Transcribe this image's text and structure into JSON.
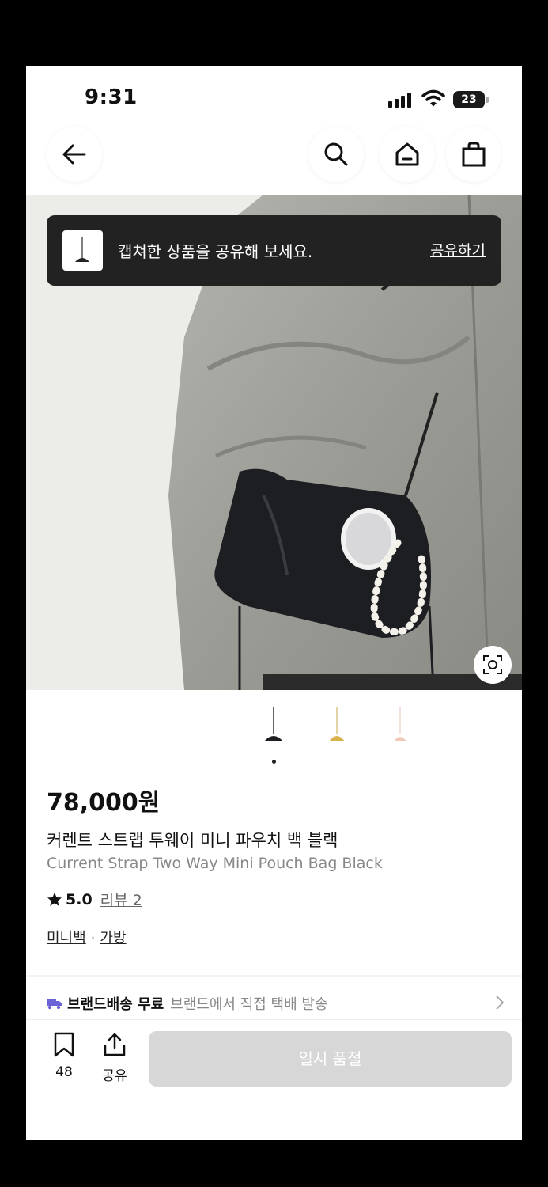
{
  "status_bar": {
    "time": "9:31",
    "battery": "23"
  },
  "toast": {
    "message": "캡쳐한 상품을 공유해 보세요.",
    "action": "공유하기"
  },
  "product": {
    "price": "78,000원",
    "name_ko": "커렌트 스트랩 투웨이 미니 파우치 백 블랙",
    "name_en": "Current Strap Two Way Mini Pouch Bag Black",
    "rating": "5.0",
    "review_link": "리뷰 2",
    "category_1": "미니백",
    "category_separator": "·",
    "category_2": "가방"
  },
  "shipping": {
    "label": "브랜드배송 무료",
    "description": "브랜드에서 직접 택배 발송"
  },
  "bottom_bar": {
    "bookmark_count": "48",
    "share_label": "공유",
    "cta_label": "일시 품절"
  },
  "icons": [
    "back-arrow-icon",
    "search-icon",
    "home-icon",
    "shopping-bag-icon",
    "lens-search-icon",
    "truck-icon",
    "chevron-right-icon",
    "bookmark-icon",
    "share-icon",
    "star-icon"
  ],
  "colors": {
    "toast_bg": "#222222",
    "cta_disabled": "#d7d7d7",
    "truck": "#6b63d6"
  }
}
